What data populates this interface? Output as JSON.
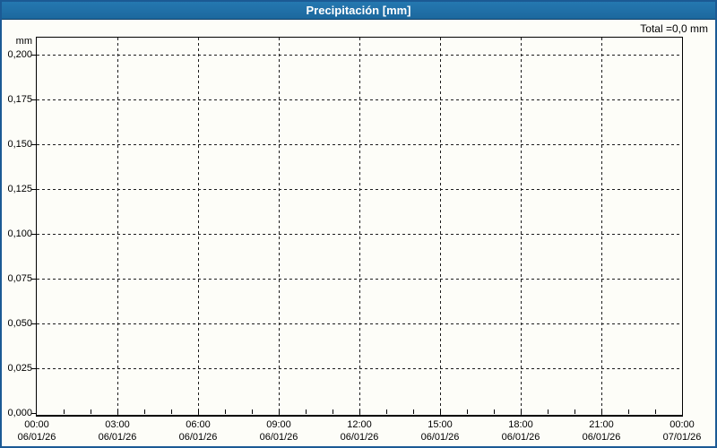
{
  "window": {
    "title": "Precipitación [mm]"
  },
  "summary": {
    "total_label": "Total =0,0 mm"
  },
  "chart_data": {
    "type": "bar",
    "title": "Precipitación [mm]",
    "subtitle": "",
    "total": "0,0 mm",
    "grid": "dashed",
    "legend_position": "none",
    "y_axis": {
      "unit": "mm",
      "min": 0.0,
      "max": 0.2,
      "tick_step": 0.025,
      "tick_labels": [
        "0,200",
        "0,175",
        "0,150",
        "0,125",
        "0,100",
        "0,075",
        "0,050",
        "0,025",
        "0,000"
      ]
    },
    "x_axis": {
      "label": "",
      "major_tick_interval_hours": 3,
      "minor_tick_interval_hours": 1,
      "range_hours": 24,
      "ticks": [
        {
          "time": "00:00",
          "date": "06/01/26"
        },
        {
          "time": "03:00",
          "date": "06/01/26"
        },
        {
          "time": "06:00",
          "date": "06/01/26"
        },
        {
          "time": "09:00",
          "date": "06/01/26"
        },
        {
          "time": "12:00",
          "date": "06/01/26"
        },
        {
          "time": "15:00",
          "date": "06/01/26"
        },
        {
          "time": "18:00",
          "date": "06/01/26"
        },
        {
          "time": "21:00",
          "date": "06/01/26"
        },
        {
          "time": "00:00",
          "date": "07/01/26"
        }
      ]
    },
    "series": [
      {
        "name": "Precipitación",
        "values_all_zero": true
      }
    ],
    "colors": {
      "titlebar": "#1e6fa6",
      "panel_border": "#1b5a94",
      "plot_border": "#000000",
      "grid": "#1c1c1c",
      "background": "#fdfdf8",
      "title_text": "#ffffff",
      "label_text": "#000000"
    }
  }
}
